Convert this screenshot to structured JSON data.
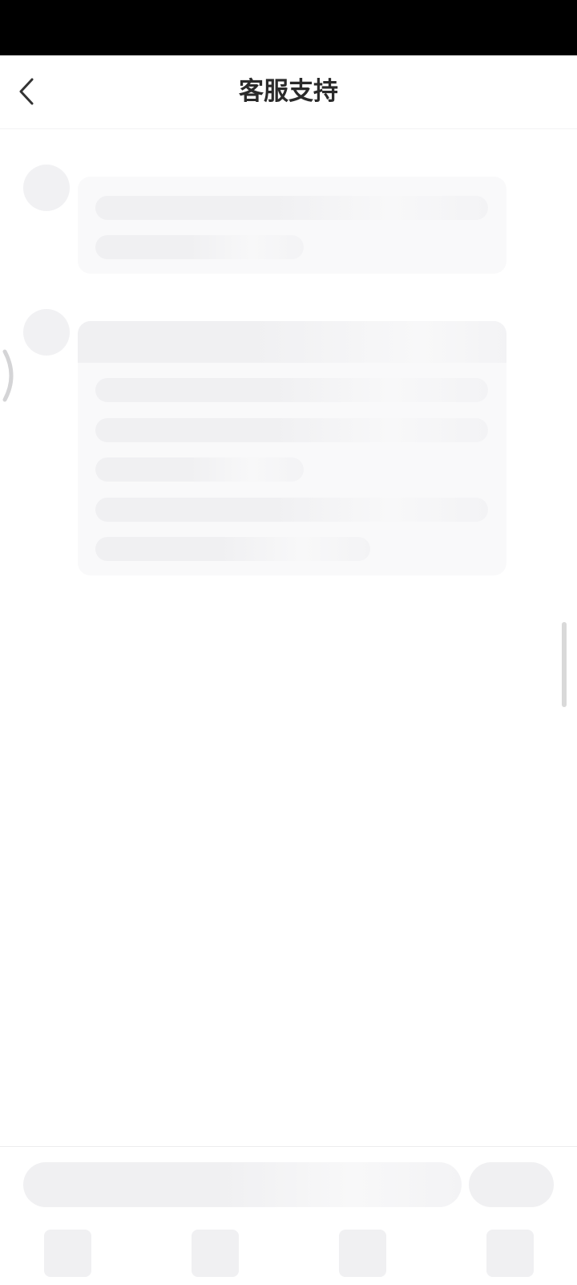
{
  "header": {
    "title": "客服支持",
    "back_icon": "chevron-left-icon"
  },
  "colors": {
    "status_bar": "#000000",
    "title_text": "#2a2a2a",
    "skeleton": "#f0f0f2",
    "bubble": "#f9f9fa",
    "scrollbar": "#d9d9d9"
  },
  "state": "loading-skeleton"
}
